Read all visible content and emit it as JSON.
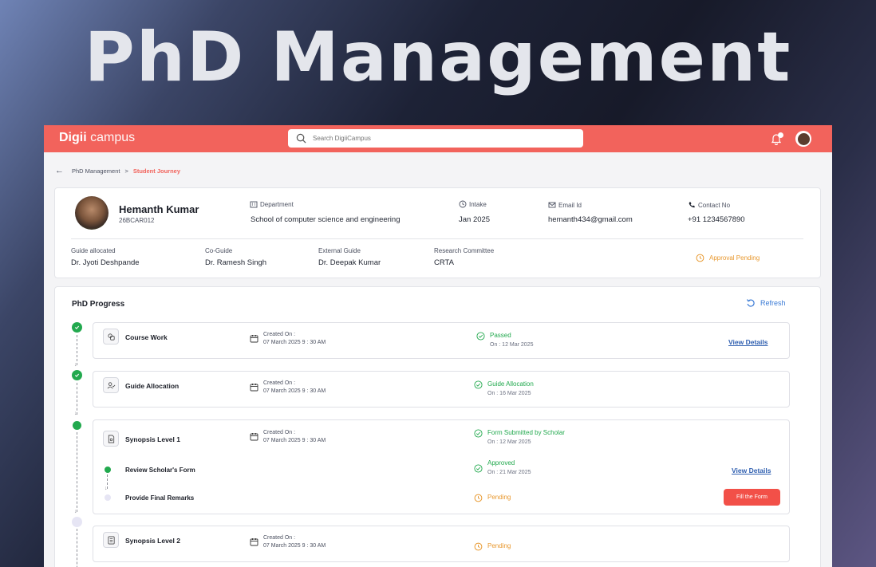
{
  "hero": {
    "title": "PhD Management"
  },
  "topbar": {
    "logo_bold": "Digii",
    "logo_light": " campus",
    "search_placeholder": "Search DigiiCampus",
    "accent": "#f2635c"
  },
  "breadcrumb": {
    "parent": "PhD Management",
    "separator": ">",
    "current": "Student Journey"
  },
  "profile": {
    "name": "Hemanth Kumar",
    "id": "26BCAR012",
    "department_label": "Department",
    "department": "School of computer science and engineering",
    "intake_label": "Intake",
    "intake": "Jan 2025",
    "email_label": "Email Id",
    "email": "hemanth434@gmail.com",
    "contact_label": "Contact No",
    "contact": "+91 1234567890",
    "guide_label": "Guide allocated",
    "guide": "Dr. Jyoti Deshpande",
    "coguide_label": "Co-Guide",
    "coguide": "Dr. Ramesh Singh",
    "external_label": "External Guide",
    "external": "Dr. Deepak Kumar",
    "committee_label": "Research Committee",
    "committee": "CRTA",
    "approval_status": "Approval Pending"
  },
  "progress": {
    "title": "PhD Progress",
    "refresh_label": "Refresh",
    "created_label": "Created On :",
    "steps": [
      {
        "name": "Course Work",
        "icon": "course-icon",
        "created": "07 March 2025 9 : 30 AM",
        "status": "Passed",
        "status_date": "On : 12 Mar 2025",
        "link": "View Details"
      },
      {
        "name": "Guide Allocation",
        "icon": "user-check-icon",
        "created": "07 March 2025 9 : 30 AM",
        "status": "Guide Allocation",
        "status_date": "On : 16 Mar 2025"
      },
      {
        "name": "Synopsis Level 1",
        "icon": "document-icon",
        "created": "07 March 2025 9 : 30 AM",
        "status": "Form Submitted by Scholar",
        "status_date": "On : 12 Mar 2025",
        "substeps": [
          {
            "name": "Review Scholar's Form",
            "status": "Approved",
            "status_date": "On : 21 Mar 2025",
            "link": "View Details"
          },
          {
            "name": "Provide Final Remarks",
            "status": "Pending",
            "button": "Fill the Form"
          }
        ]
      },
      {
        "name": "Synopsis Level 2",
        "icon": "list-document-icon",
        "created": "07 March 2025 9 : 30 AM",
        "status": "Pending"
      }
    ]
  }
}
